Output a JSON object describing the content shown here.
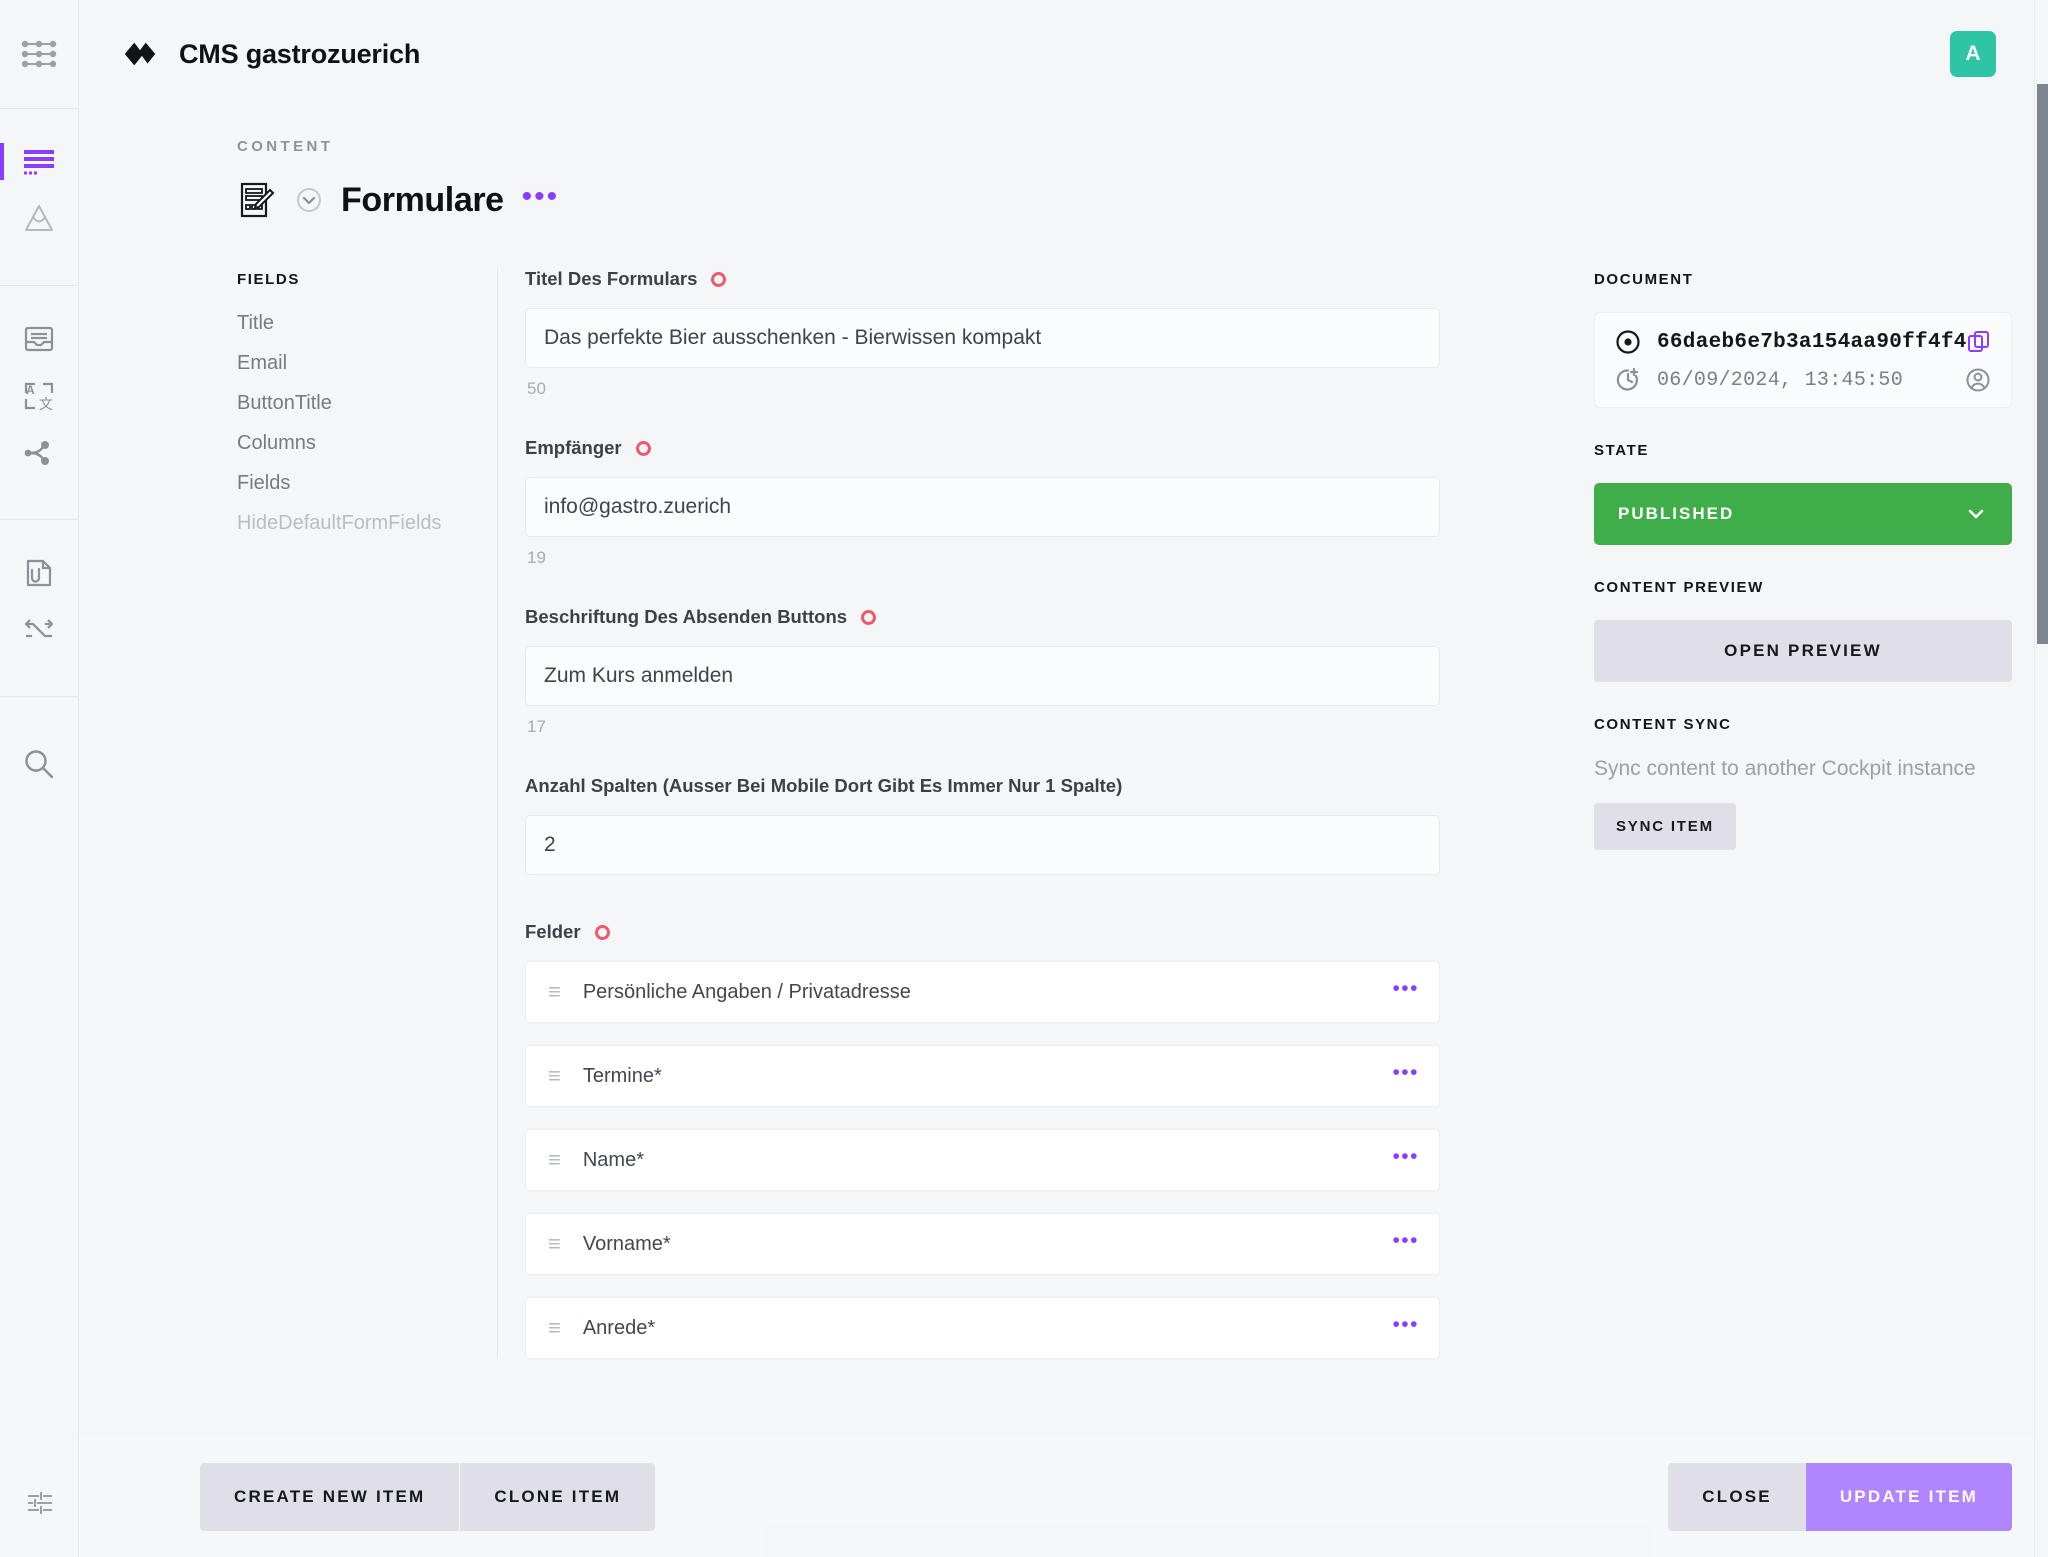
{
  "rail": {
    "logo_icon": "nodes-grid-icon",
    "items": [
      {
        "name": "content",
        "icon": "list-lines-icon",
        "active": true
      },
      {
        "name": "assets-triangle",
        "icon": "triangle-loop-icon",
        "active": false
      },
      {
        "name": "inbox",
        "icon": "inbox-tray-icon",
        "active": false
      },
      {
        "name": "locales",
        "icon": "translate-icon",
        "active": false
      },
      {
        "name": "workflows",
        "icon": "nodes-connect-icon",
        "active": false
      },
      {
        "name": "files",
        "icon": "file-attach-icon",
        "active": false
      },
      {
        "name": "sync",
        "icon": "shuffle-arrows-icon",
        "active": false
      },
      {
        "name": "search",
        "icon": "search-icon",
        "active": false
      }
    ],
    "bottom_icon": "sliders-settings-icon"
  },
  "topbar": {
    "brand_logo_icon": "cockpit-logo-icon",
    "brand_name": "CMS gastrozuerich",
    "avatar_initial": "A",
    "avatar_color": "#2ec4a6"
  },
  "page": {
    "eyebrow": "CONTENT",
    "collection_icon": "form-document-edit-icon",
    "state_chevron_icon": "chevron-down-circle-icon",
    "title": "Formulare",
    "more_icon": "more-dots-icon"
  },
  "fields_panel": {
    "label": "FIELDS",
    "items": [
      {
        "label": "Title",
        "muted": false
      },
      {
        "label": "Email",
        "muted": false
      },
      {
        "label": "ButtonTitle",
        "muted": false
      },
      {
        "label": "Columns",
        "muted": false
      },
      {
        "label": "Fields",
        "muted": false
      },
      {
        "label": "HideDefaultFormFields",
        "muted": true
      }
    ]
  },
  "form": {
    "groups": [
      {
        "label": "Titel Des Formulars",
        "required": true,
        "value": "Das perfekte Bier ausschenken - Bierwissen kompakt",
        "count": "50"
      },
      {
        "label": "Empfänger",
        "required": true,
        "value": "info@gastro.zuerich",
        "count": "19"
      },
      {
        "label": "Beschriftung Des Absenden Buttons",
        "required": true,
        "value": "Zum Kurs anmelden",
        "count": "17"
      },
      {
        "label": "Anzahl Spalten (Ausser Bei Mobile Dort Gibt Es Immer Nur 1 Spalte)",
        "required": false,
        "value": "2",
        "count": ""
      }
    ],
    "felder": {
      "label": "Felder",
      "required": true,
      "items": [
        {
          "name": "Persönliche Angaben / Privatadresse"
        },
        {
          "name": "Termine*"
        },
        {
          "name": "Name*"
        },
        {
          "name": "Vorname*"
        },
        {
          "name": "Anrede*"
        }
      ]
    }
  },
  "sidepanel": {
    "document_label": "DOCUMENT",
    "document_id": "66daeb6e7b3a154aa90ff4f4",
    "document_id_icon": "target-dot-icon",
    "copy_icon": "copy-icon",
    "created_icon": "clock-plus-icon",
    "created_at": "06/09/2024, 13:45:50",
    "user_icon": "user-circle-icon",
    "state_label": "STATE",
    "state_value": "PUBLISHED",
    "state_color": "#3fae49",
    "state_chevron_icon": "chevron-down-icon",
    "preview_label": "CONTENT PREVIEW",
    "preview_button": "OPEN PREVIEW",
    "sync_label": "CONTENT SYNC",
    "sync_description": "Sync content to another Cockpit instance",
    "sync_button": "SYNC ITEM"
  },
  "bottombar": {
    "create_new_item": "CREATE NEW ITEM",
    "clone_item": "CLONE ITEM",
    "close": "CLOSE",
    "update_item": "UPDATE ITEM",
    "primary_color": "#b085fd"
  }
}
